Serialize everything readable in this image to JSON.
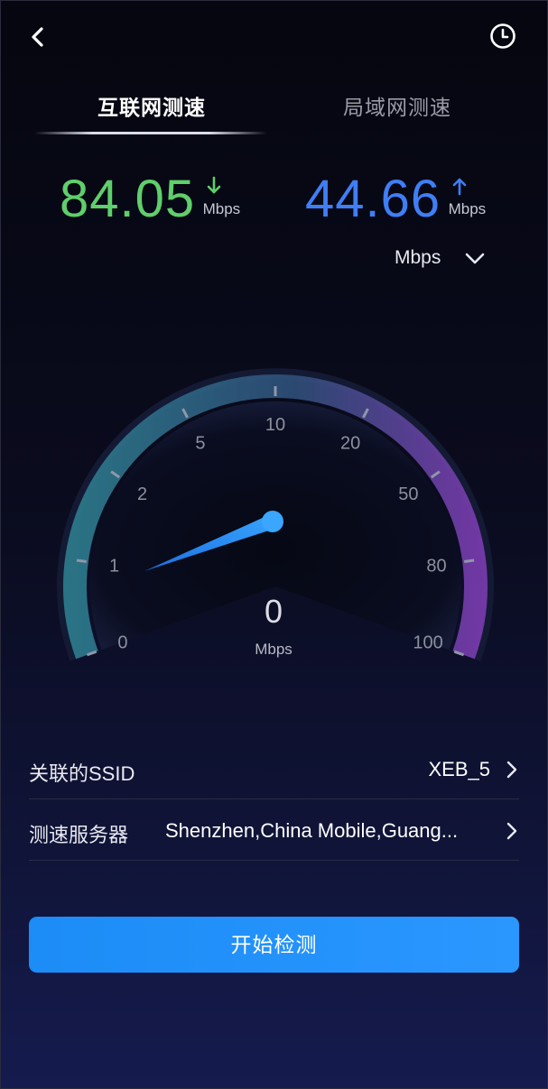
{
  "colors": {
    "download": "#5fcf6b",
    "upload": "#3f7ef5",
    "button": "#1f8ef8",
    "gauge_start": "#2d7d8f",
    "gauge_end": "#7a3cb0"
  },
  "header": {
    "back_icon": "chevron-left-icon",
    "history_icon": "clock-icon"
  },
  "tabs": [
    {
      "label": "互联网测速",
      "active": true
    },
    {
      "label": "局域网测速",
      "active": false
    }
  ],
  "download": {
    "value": "84.05",
    "unit": "Mbps",
    "icon": "arrow-down-icon"
  },
  "upload": {
    "value": "44.66",
    "unit": "Mbps",
    "icon": "arrow-up-icon"
  },
  "unit_selector": {
    "value": "Mbps",
    "icon": "chevron-down-icon"
  },
  "gauge": {
    "scale_labels": [
      "0",
      "1",
      "2",
      "5",
      "10",
      "20",
      "50",
      "80",
      "100"
    ],
    "current_value": "0",
    "unit": "Mbps"
  },
  "info_rows": [
    {
      "label": "关联的SSID",
      "value": "XEB_5"
    },
    {
      "label": "测速服务器",
      "value": "Shenzhen,China Mobile,Guang..."
    }
  ],
  "start_button": {
    "label": "开始检测"
  }
}
